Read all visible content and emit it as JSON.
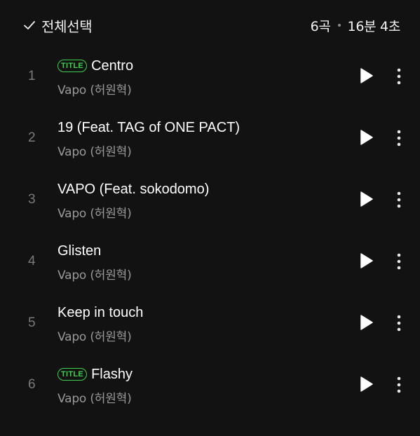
{
  "header": {
    "select_all_label": "전체선택",
    "track_count": "6곡",
    "total_duration": "16분 4초",
    "check_icon": "check-icon"
  },
  "colors": {
    "background": "#121212",
    "title_badge": "#3fd24f",
    "artist_text": "#9a9a9a",
    "track_number": "#7a7a7a"
  },
  "tracks": [
    {
      "number": "1",
      "title": "Centro",
      "artist": "Vapo (허원혁)",
      "badge": "TITLE"
    },
    {
      "number": "2",
      "title": "19 (Feat. TAG of ONE PACT)",
      "artist": "Vapo (허원혁)",
      "badge": ""
    },
    {
      "number": "3",
      "title": "VAPO (Feat. sokodomo)",
      "artist": "Vapo (허원혁)",
      "badge": ""
    },
    {
      "number": "4",
      "title": "Glisten",
      "artist": "Vapo (허원혁)",
      "badge": ""
    },
    {
      "number": "5",
      "title": "Keep in touch",
      "artist": "Vapo (허원혁)",
      "badge": ""
    },
    {
      "number": "6",
      "title": "Flashy",
      "artist": "Vapo (허원혁)",
      "badge": "TITLE"
    }
  ],
  "icons": {
    "play": "play-icon",
    "more": "more-vertical-icon"
  }
}
